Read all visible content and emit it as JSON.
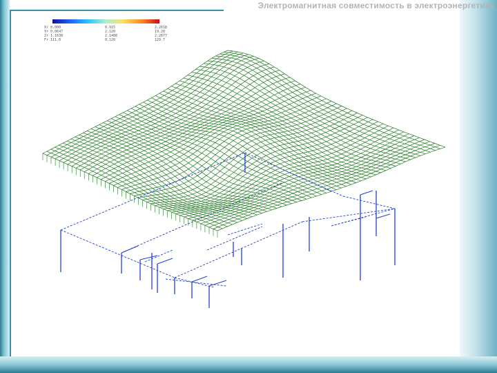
{
  "slide": {
    "title": "Электромагнитная совместимость в электроэнергетике"
  },
  "legend": {
    "rows": [
      {
        "c0": "Xr 0.000",
        "c1": "0.915",
        "c2": "2.2618"
      },
      {
        "c0": "Yr 0.0647",
        "c1": "2.120",
        "c2": "19.20"
      },
      {
        "c0": "Zr 1.1638",
        "c1": "2.1488",
        "c2": "2.2677"
      },
      {
        "c0": "Fr 111.0",
        "c1": "0.120",
        "c2": "129.7"
      }
    ],
    "colors": [
      "#1010a0",
      "#1a6cff",
      "#2ec8ff",
      "#aef0c8",
      "#ffe060",
      "#ff8a20",
      "#c81010"
    ]
  },
  "figure": {
    "surface_color": "#1f7a1f",
    "grounding_grid_color": "#1f3fd8"
  }
}
